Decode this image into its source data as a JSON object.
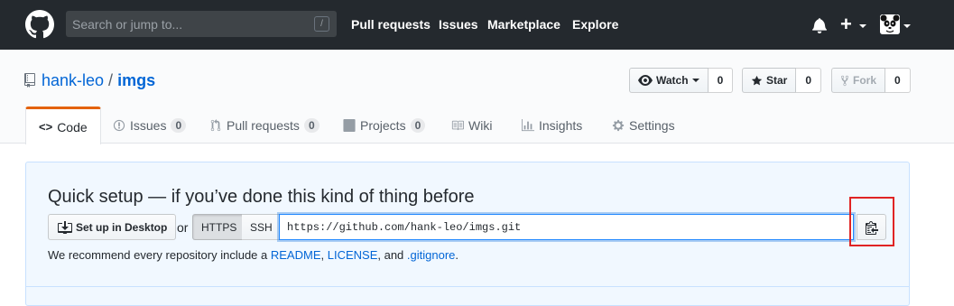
{
  "header": {
    "search_placeholder": "Search or jump to...",
    "slash_key": "/",
    "nav": [
      "Pull requests",
      "Issues",
      "Marketplace",
      "Explore"
    ],
    "plus_label": "+"
  },
  "repo": {
    "owner": "hank-leo",
    "separator": "/",
    "name": "imgs",
    "watch_label": "Watch",
    "watch_count": "0",
    "star_label": "Star",
    "star_count": "0",
    "fork_label": "Fork",
    "fork_count": "0"
  },
  "tabs": [
    {
      "label": "Code",
      "icon": "code-icon",
      "selected": true
    },
    {
      "label": "Issues",
      "icon": "issue-icon",
      "counter": "0"
    },
    {
      "label": "Pull requests",
      "icon": "pull-request-icon",
      "counter": "0"
    },
    {
      "label": "Projects",
      "icon": "project-icon",
      "counter": "0"
    },
    {
      "label": "Wiki",
      "icon": "book-icon"
    },
    {
      "label": "Insights",
      "icon": "graph-icon"
    },
    {
      "label": "Settings",
      "icon": "gear-icon"
    }
  ],
  "quick_setup": {
    "title": "Quick setup — if you’ve done this kind of thing before",
    "desktop_button": "Set up in Desktop",
    "or": "or",
    "https": "HTTPS",
    "ssh": "SSH",
    "clone_url": "https://github.com/hank-leo/imgs.git",
    "recommend_prefix": "We recommend every repository include a ",
    "readme": "README",
    "comma1": ", ",
    "license": "LICENSE",
    "and": ", and ",
    "gitignore": ".gitignore",
    "period": "."
  },
  "colors": {
    "header_bg": "#24292e",
    "link": "#0366d6",
    "tab_accent": "#e36209",
    "quick_bg": "#f1f8ff",
    "highlight": "#e02424"
  }
}
